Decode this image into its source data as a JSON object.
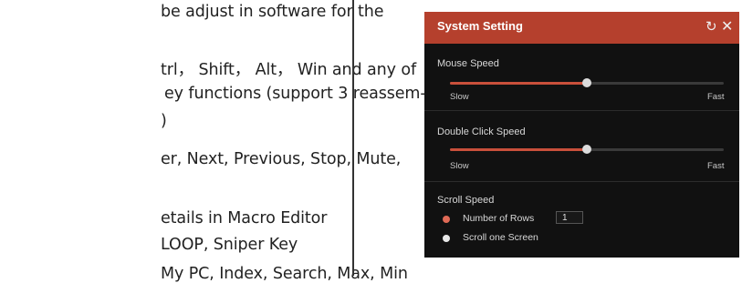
{
  "document": {
    "lines": [
      "be adjust in software for the",
      "trl， Shift， Alt， Win and any of",
      "ey functions (support 3 reassem-",
      ")",
      "er, Next, Previous, Stop, Mute,",
      "etails in Macro Editor",
      "LOOP, Sniper Key",
      "My PC, Index, Search, Max, Min"
    ]
  },
  "dialog": {
    "title": "System Setting",
    "refresh_icon": "refresh-icon",
    "close_icon": "close-icon",
    "accent": "#b5402d",
    "mouse_speed": {
      "label": "Mouse Speed",
      "value_fraction": 0.5,
      "min_label": "Slow",
      "max_label": "Fast"
    },
    "double_click_speed": {
      "label": "Double Click Speed",
      "value_fraction": 0.5,
      "min_label": "Slow",
      "max_label": "Fast"
    },
    "scroll_speed": {
      "label": "Scroll Speed",
      "options": [
        {
          "label": "Number of Rows",
          "selected": true
        },
        {
          "label": "Scroll one Screen",
          "selected": false
        }
      ],
      "rows_value": "1"
    }
  }
}
